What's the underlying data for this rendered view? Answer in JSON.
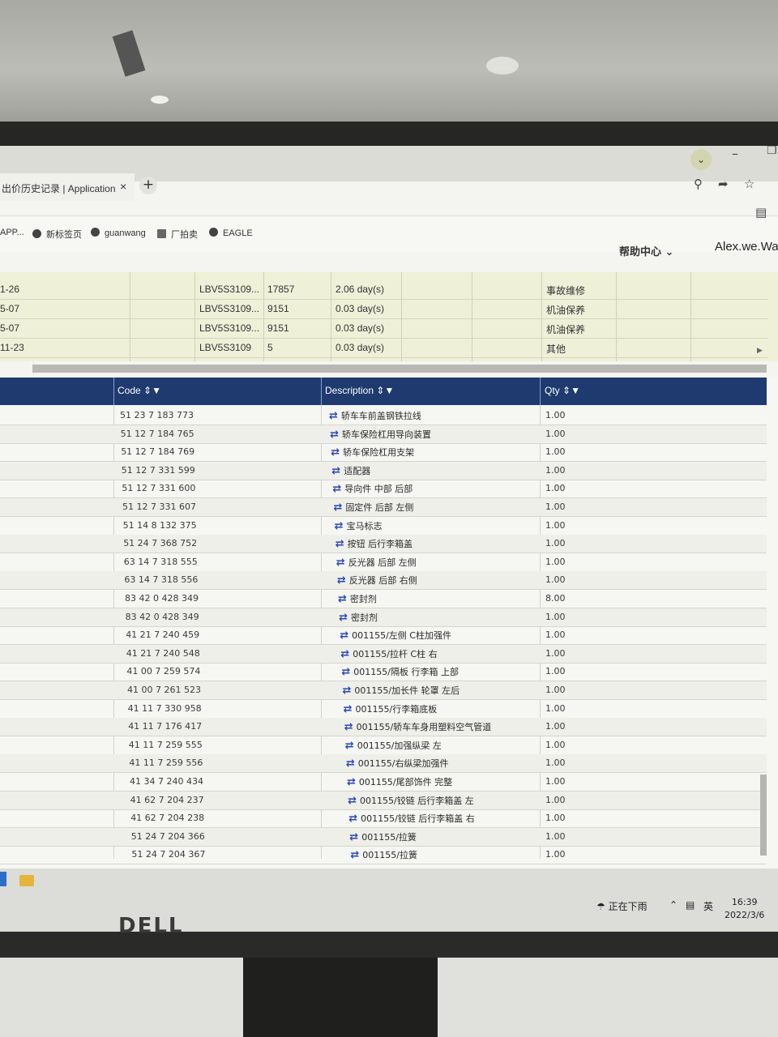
{
  "browser": {
    "tab_title": "出价历史记录 | Application",
    "tab_close": "×",
    "new_tab": "+"
  },
  "bookmarks": [
    {
      "label": "APP..."
    },
    {
      "label": "新标签页"
    },
    {
      "label": "guanwang"
    },
    {
      "label": "厂拍卖"
    },
    {
      "label": "EAGLE"
    }
  ],
  "header": {
    "help": "帮助中心",
    "user": "Alex.we.Wan"
  },
  "upper_table": {
    "rows": [
      {
        "date": "1-26",
        "vin": "LBV5S3109...",
        "num": "17857",
        "days": "2.06 day(s)",
        "type": "事故维修"
      },
      {
        "date": "5-07",
        "vin": "LBV5S3109...",
        "num": "9151",
        "days": "0.03 day(s)",
        "type": "机油保养"
      },
      {
        "date": "5-07",
        "vin": "LBV5S3109...",
        "num": "9151",
        "days": "0.03 day(s)",
        "type": "机油保养"
      },
      {
        "date": "11-23",
        "vin": "LBV5S3109",
        "num": "5",
        "days": "0.03 day(s)",
        "type": "其他"
      }
    ]
  },
  "lower_table": {
    "headers": {
      "code": "Code",
      "description": "Description",
      "qty": "Qty"
    },
    "rows": [
      {
        "code": "51 23 7 183 773",
        "description": "轿车车前盖钢铁拉线",
        "qty": "1.00"
      },
      {
        "code": "51 12 7 184 765",
        "description": "轿车保险杠用导向装置",
        "qty": "1.00"
      },
      {
        "code": "51 12 7 184 769",
        "description": "轿车保险杠用支架",
        "qty": "1.00"
      },
      {
        "code": "51 12 7 331 599",
        "description": "适配器",
        "qty": "1.00"
      },
      {
        "code": "51 12 7 331 600",
        "description": "导向件 中部 后部",
        "qty": "1.00"
      },
      {
        "code": "51 12 7 331 607",
        "description": "固定件 后部 左侧",
        "qty": "1.00"
      },
      {
        "code": "51 14 8 132 375",
        "description": "宝马标志",
        "qty": "1.00"
      },
      {
        "code": "51 24 7 368 752",
        "description": "按钮 后行李箱盖",
        "qty": "1.00"
      },
      {
        "code": "63 14 7 318 555",
        "description": "反光器 后部 左侧",
        "qty": "1.00"
      },
      {
        "code": "63 14 7 318 556",
        "description": "反光器 后部 右侧",
        "qty": "1.00"
      },
      {
        "code": "83 42 0 428 349",
        "description": "密封剂",
        "qty": "8.00"
      },
      {
        "code": "83 42 0 428 349",
        "description": "密封剂",
        "qty": "1.00"
      },
      {
        "code": "41 21 7 240 459",
        "description": "001155/左侧 C柱加强件",
        "qty": "1.00"
      },
      {
        "code": "41 21 7 240 548",
        "description": "001155/拉杆 C柱 右",
        "qty": "1.00"
      },
      {
        "code": "41 00 7 259 574",
        "description": "001155/隔板 行李箱 上部",
        "qty": "1.00"
      },
      {
        "code": "41 00 7 261 523",
        "description": "001155/加长件 轮罩 左后",
        "qty": "1.00"
      },
      {
        "code": "41 11 7 330 958",
        "description": "001155/行李箱底板",
        "qty": "1.00"
      },
      {
        "code": "41 11 7 176 417",
        "description": "001155/轿车车身用塑料空气管道",
        "qty": "1.00"
      },
      {
        "code": "41 11 7 259 555",
        "description": "001155/加强纵梁 左",
        "qty": "1.00"
      },
      {
        "code": "41 11 7 259 556",
        "description": "001155/右纵梁加强件",
        "qty": "1.00"
      },
      {
        "code": "41 34 7 240 434",
        "description": "001155/尾部饰件 完整",
        "qty": "1.00"
      },
      {
        "code": "41 62 7 204 237",
        "description": "001155/铰链 后行李箱盖 左",
        "qty": "1.00"
      },
      {
        "code": "41 62 7 204 238",
        "description": "001155/铰链 后行李箱盖 右",
        "qty": "1.00"
      },
      {
        "code": "51 24 7 204 366",
        "description": "001155/拉簧",
        "qty": "1.00"
      },
      {
        "code": "51 24 7 204 367",
        "description": "001155/拉簧",
        "qty": "1.00"
      }
    ]
  },
  "taskbar": {
    "weather": "正在下雨",
    "ime": "英",
    "time": "16:39",
    "date": "2022/3/6"
  },
  "monitor_brand": "DELL"
}
